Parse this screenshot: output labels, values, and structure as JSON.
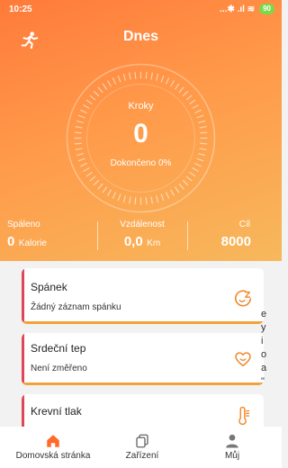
{
  "status_bar": {
    "time": "10:25",
    "icons": "...✱ .ıl ≋",
    "battery": "90"
  },
  "header": {
    "title": "Dnes",
    "run_icon": "runner-icon"
  },
  "ring": {
    "label": "Kroky",
    "value": "0",
    "completion": "Dokončeno 0%",
    "progress_fraction": 0
  },
  "stats": {
    "burned": {
      "label": "Spáleno",
      "value": "0",
      "unit": "Kalorie"
    },
    "distance": {
      "label": "Vzdálenost",
      "value": "0,0",
      "unit": "Km"
    },
    "goal": {
      "label": "Cíl",
      "value": "8000"
    }
  },
  "cards": [
    {
      "title": "Spánek",
      "subtitle": "Žádný záznam spánku",
      "icon": "sleep-icon"
    },
    {
      "title": "Srdeční tep",
      "subtitle": "Není změřeno",
      "icon": "heart-icon"
    },
    {
      "title": "Krevní tlak",
      "subtitle": "",
      "icon": "thermometer-icon"
    }
  ],
  "side_text": [
    "e",
    "y",
    "i",
    "o",
    "a",
    "\""
  ],
  "tabs": [
    {
      "label": "Domovská stránka",
      "icon": "home-icon",
      "active": true
    },
    {
      "label": "Zařízení",
      "icon": "device-icon",
      "active": false
    },
    {
      "label": "Můj",
      "icon": "profile-icon",
      "active": false
    }
  ],
  "colors": {
    "accent": "#ff7a3a",
    "card_left_bar": "#e0465a",
    "card_bottom_bar": "#f2a23a",
    "icon_orange": "#f28a2e",
    "tab_active": "#ff6a2a"
  }
}
